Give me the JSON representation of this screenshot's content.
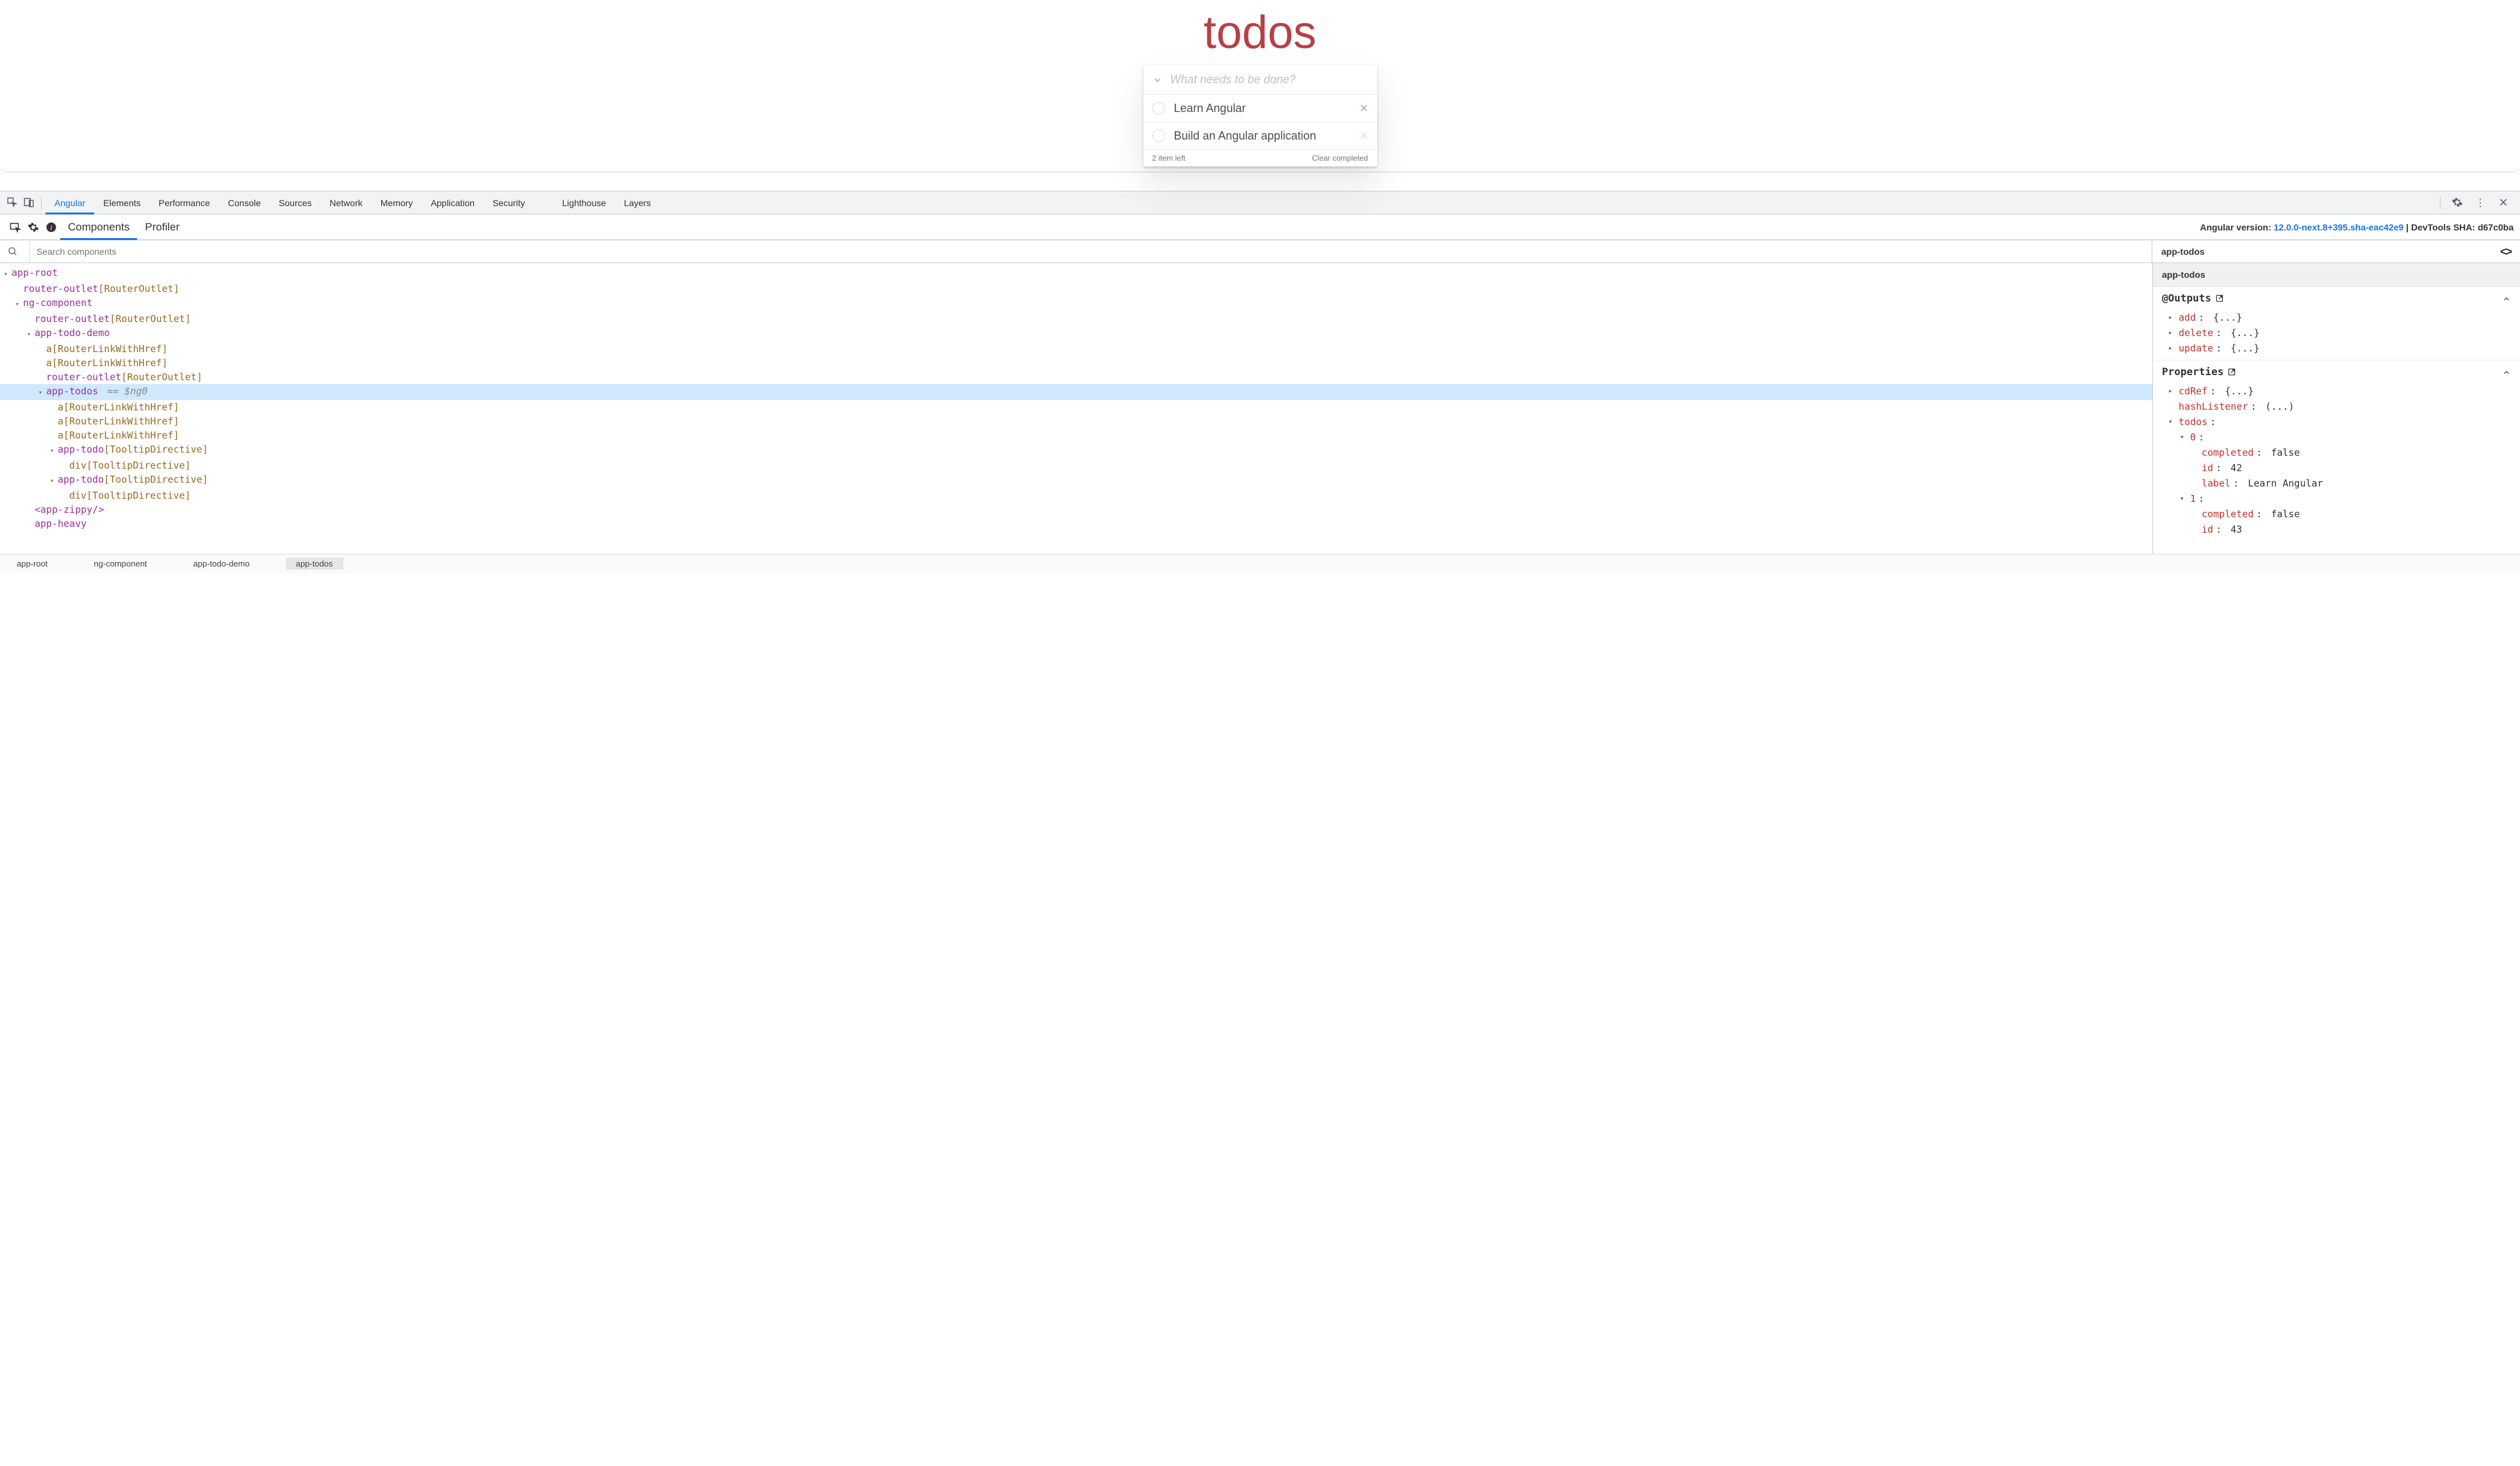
{
  "app": {
    "title": "todos",
    "input_placeholder": "What needs to be done?",
    "items": [
      {
        "label": "Learn Angular"
      },
      {
        "label": "Build an Angular application"
      }
    ],
    "count_text": "2 item left",
    "clear_text": "Clear completed"
  },
  "devtools": {
    "tabs": [
      "Angular",
      "Elements",
      "Performance",
      "Console",
      "Sources",
      "Network",
      "Memory",
      "Application",
      "Security",
      "Lighthouse",
      "Layers"
    ],
    "active_tab": "Angular"
  },
  "ng": {
    "tabs": {
      "components": "Components",
      "profiler": "Profiler"
    },
    "version_prefix": "Angular version: ",
    "version": "12.0.0-next.8+395.sha-eac42e9",
    "sha_label": " | DevTools SHA: d67c0ba",
    "search_placeholder": "Search components",
    "selected_header": "app-todos",
    "breadcrumb": [
      "app-root",
      "ng-component",
      "app-todo-demo",
      "app-todos"
    ]
  },
  "tree": {
    "rows": [
      {
        "indent": 0,
        "caret": "v",
        "parts": [
          {
            "t": "app-root",
            "c": "comp"
          }
        ]
      },
      {
        "indent": 1,
        "caret": "",
        "parts": [
          {
            "t": "router-outlet",
            "c": "comp"
          },
          {
            "t": "[",
            "c": "dirbracket"
          },
          {
            "t": "RouterOutlet",
            "c": "dir"
          },
          {
            "t": "]",
            "c": "dirbracket"
          }
        ]
      },
      {
        "indent": 1,
        "caret": "v",
        "parts": [
          {
            "t": "ng-component",
            "c": "comp"
          }
        ]
      },
      {
        "indent": 2,
        "caret": "",
        "parts": [
          {
            "t": "router-outlet",
            "c": "comp"
          },
          {
            "t": "[",
            "c": "dirbracket"
          },
          {
            "t": "RouterOutlet",
            "c": "dir"
          },
          {
            "t": "]",
            "c": "dirbracket"
          }
        ]
      },
      {
        "indent": 2,
        "caret": "v",
        "parts": [
          {
            "t": "app-todo-demo",
            "c": "comp"
          }
        ]
      },
      {
        "indent": 3,
        "caret": "",
        "parts": [
          {
            "t": "a",
            "c": "tagtext"
          },
          {
            "t": "[",
            "c": "dirbracket"
          },
          {
            "t": "RouterLinkWithHref",
            "c": "dir"
          },
          {
            "t": "]",
            "c": "dirbracket"
          }
        ]
      },
      {
        "indent": 3,
        "caret": "",
        "parts": [
          {
            "t": "a",
            "c": "tagtext"
          },
          {
            "t": "[",
            "c": "dirbracket"
          },
          {
            "t": "RouterLinkWithHref",
            "c": "dir"
          },
          {
            "t": "]",
            "c": "dirbracket"
          }
        ]
      },
      {
        "indent": 3,
        "caret": "",
        "parts": [
          {
            "t": "router-outlet",
            "c": "comp"
          },
          {
            "t": "[",
            "c": "dirbracket"
          },
          {
            "t": "RouterOutlet",
            "c": "dir"
          },
          {
            "t": "]",
            "c": "dirbracket"
          }
        ]
      },
      {
        "indent": 3,
        "caret": "v",
        "selected": true,
        "parts": [
          {
            "t": "app-todos",
            "c": "comp"
          }
        ],
        "suffix": "== $ng0"
      },
      {
        "indent": 4,
        "caret": "",
        "parts": [
          {
            "t": "a",
            "c": "tagtext"
          },
          {
            "t": "[",
            "c": "dirbracket"
          },
          {
            "t": "RouterLinkWithHref",
            "c": "dir"
          },
          {
            "t": "]",
            "c": "dirbracket"
          }
        ]
      },
      {
        "indent": 4,
        "caret": "",
        "parts": [
          {
            "t": "a",
            "c": "tagtext"
          },
          {
            "t": "[",
            "c": "dirbracket"
          },
          {
            "t": "RouterLinkWithHref",
            "c": "dir"
          },
          {
            "t": "]",
            "c": "dirbracket"
          }
        ]
      },
      {
        "indent": 4,
        "caret": "",
        "parts": [
          {
            "t": "a",
            "c": "tagtext"
          },
          {
            "t": "[",
            "c": "dirbracket"
          },
          {
            "t": "RouterLinkWithHref",
            "c": "dir"
          },
          {
            "t": "]",
            "c": "dirbracket"
          }
        ]
      },
      {
        "indent": 4,
        "caret": "v",
        "parts": [
          {
            "t": "app-todo",
            "c": "comp"
          },
          {
            "t": "[",
            "c": "dirbracket"
          },
          {
            "t": "TooltipDirective",
            "c": "dir"
          },
          {
            "t": "]",
            "c": "dirbracket"
          }
        ]
      },
      {
        "indent": 5,
        "caret": "",
        "parts": [
          {
            "t": "div",
            "c": "tagtext"
          },
          {
            "t": "[",
            "c": "dirbracket"
          },
          {
            "t": "TooltipDirective",
            "c": "dir"
          },
          {
            "t": "]",
            "c": "dirbracket"
          }
        ]
      },
      {
        "indent": 4,
        "caret": "v",
        "parts": [
          {
            "t": "app-todo",
            "c": "comp"
          },
          {
            "t": "[",
            "c": "dirbracket"
          },
          {
            "t": "TooltipDirective",
            "c": "dir"
          },
          {
            "t": "]",
            "c": "dirbracket"
          }
        ]
      },
      {
        "indent": 5,
        "caret": "",
        "parts": [
          {
            "t": "div",
            "c": "tagtext"
          },
          {
            "t": "[",
            "c": "dirbracket"
          },
          {
            "t": "TooltipDirective",
            "c": "dir"
          },
          {
            "t": "]",
            "c": "dirbracket"
          }
        ]
      },
      {
        "indent": 2,
        "caret": "",
        "parts": [
          {
            "t": "<app-zippy/>",
            "c": "comp"
          }
        ]
      },
      {
        "indent": 2,
        "caret": "",
        "parts": [
          {
            "t": "app-heavy",
            "c": "comp"
          }
        ]
      }
    ]
  },
  "props": {
    "header": "app-todos",
    "outputs_label": "@Outputs",
    "outputs": [
      {
        "key": "add",
        "val": "{...}",
        "caret": ">"
      },
      {
        "key": "delete",
        "val": "{...}",
        "caret": ">"
      },
      {
        "key": "update",
        "val": "{...}",
        "caret": ">"
      }
    ],
    "properties_label": "Properties",
    "rows": [
      {
        "indent": 0,
        "caret": ">",
        "key": "cdRef",
        "colon": " :",
        "val": "{...}"
      },
      {
        "indent": 0,
        "caret": "",
        "key": "hashListener",
        "colon": ":",
        "val": "(...)"
      },
      {
        "indent": 0,
        "caret": "v",
        "key": "todos",
        "colon": " :",
        "val": ""
      },
      {
        "indent": 1,
        "caret": "v",
        "key": "0",
        "colon": " :",
        "val": ""
      },
      {
        "indent": 2,
        "caret": "",
        "key": "completed",
        "colon": ":",
        "val": "false"
      },
      {
        "indent": 2,
        "caret": "",
        "key": "id",
        "colon": ":",
        "val": "42"
      },
      {
        "indent": 2,
        "caret": "",
        "key": "label",
        "colon": ":",
        "val": "Learn Angular"
      },
      {
        "indent": 1,
        "caret": "v",
        "key": "1",
        "colon": " :",
        "val": ""
      },
      {
        "indent": 2,
        "caret": "",
        "key": "completed",
        "colon": ":",
        "val": "false"
      },
      {
        "indent": 2,
        "caret": "",
        "key": "id",
        "colon": ":",
        "val": "43"
      }
    ]
  }
}
